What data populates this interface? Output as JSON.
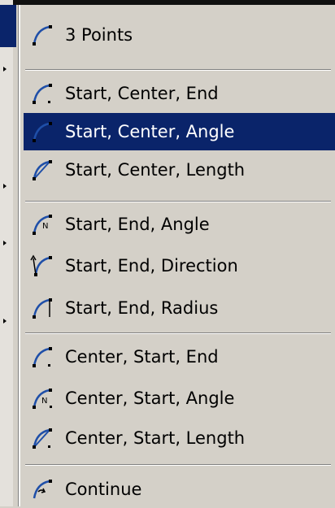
{
  "menu": {
    "items": [
      {
        "label": "3 Points",
        "icon": "arc-3-points-icon"
      },
      {
        "label": "Start, Center, End",
        "icon": "arc-start-center-end-icon"
      },
      {
        "label": "Start, Center, Angle",
        "icon": "arc-start-center-angle-icon",
        "selected": true
      },
      {
        "label": "Start, Center, Length",
        "icon": "arc-start-center-length-icon"
      },
      {
        "label": "Start, End, Angle",
        "icon": "arc-start-end-angle-icon"
      },
      {
        "label": "Start, End, Direction",
        "icon": "arc-start-end-direction-icon"
      },
      {
        "label": "Start, End, Radius",
        "icon": "arc-start-end-radius-icon"
      },
      {
        "label": "Center, Start, End",
        "icon": "arc-center-start-end-icon"
      },
      {
        "label": "Center, Start, Angle",
        "icon": "arc-center-start-angle-icon"
      },
      {
        "label": "Center, Start, Length",
        "icon": "arc-center-start-length-icon"
      },
      {
        "label": "Continue",
        "icon": "arc-continue-icon"
      }
    ]
  },
  "colors": {
    "menu_background": "#d4d0c8",
    "selection": "#0a246a",
    "icon_blue": "#1f4fa8"
  }
}
